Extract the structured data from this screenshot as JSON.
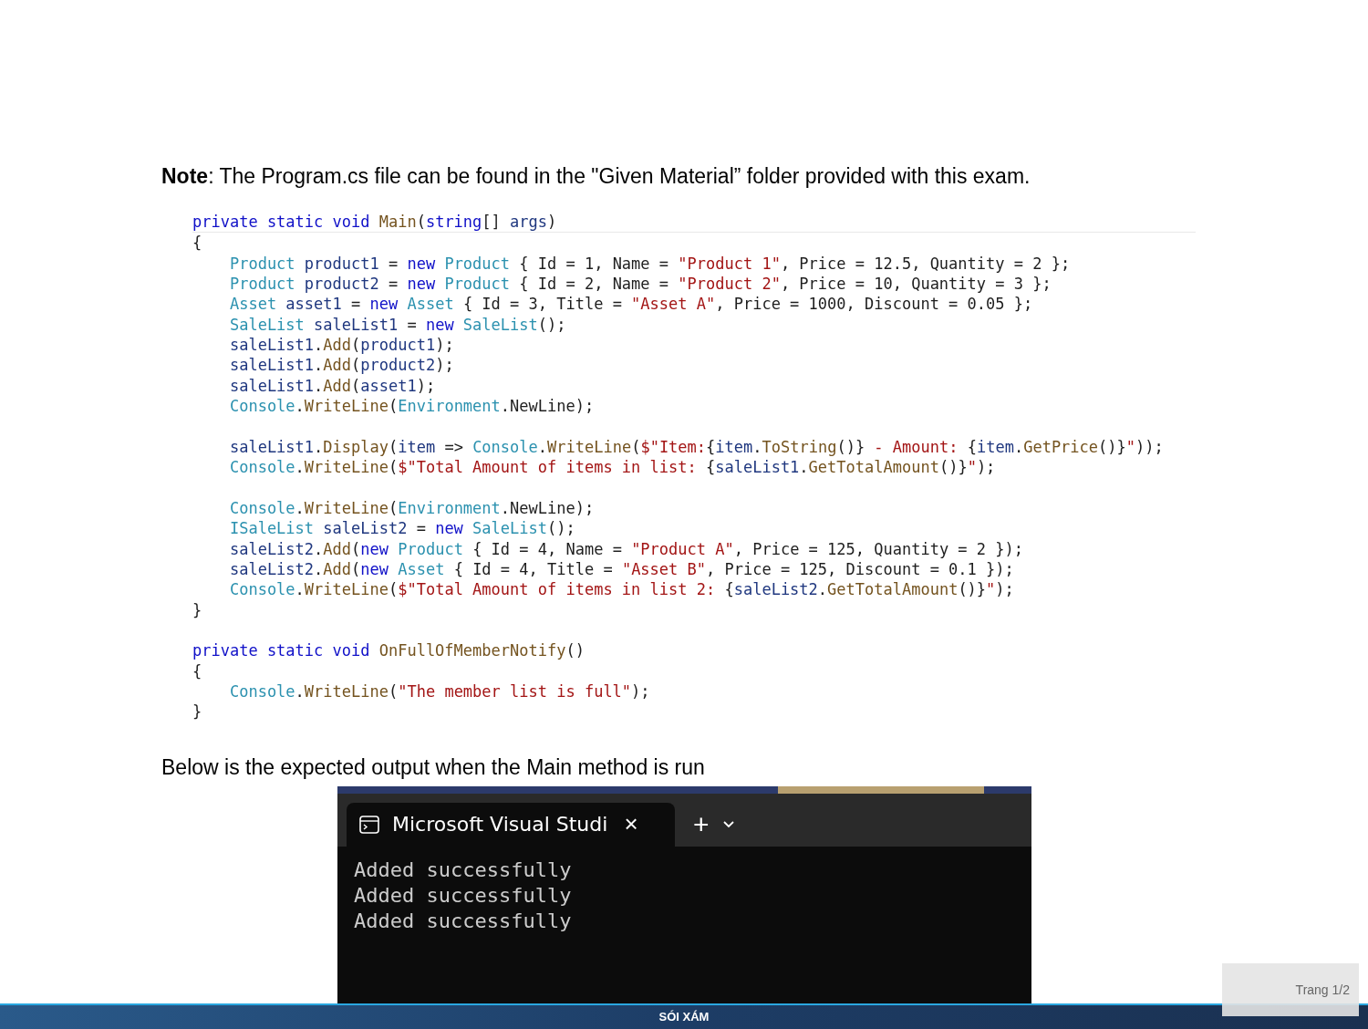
{
  "note": "**Note**: The Program.cs file can be found in the \"Given Material” folder provided with this exam.",
  "code_blocks": [
    {
      "lines": [
        {
          "tokens": [
            {
              "kind": "kw",
              "text": "private static void "
            },
            {
              "kind": "method",
              "text": "Main"
            },
            {
              "kind": "plain",
              "text": "("
            },
            {
              "kind": "kw",
              "text": "string"
            },
            {
              "kind": "plain",
              "text": "[] "
            },
            {
              "kind": "var",
              "text": "args"
            },
            {
              "kind": "plain",
              "text": ")"
            }
          ]
        },
        {
          "tokens": [
            {
              "kind": "plain",
              "text": "{"
            }
          ]
        },
        {
          "tokens": [
            {
              "kind": "type",
              "text": "    Product "
            },
            {
              "kind": "var",
              "text": "product1"
            },
            {
              "kind": "plain",
              "text": " = "
            },
            {
              "kind": "kw",
              "text": "new "
            },
            {
              "kind": "type",
              "text": "Product"
            },
            {
              "kind": "plain",
              "text": " { Id = 1, Name = "
            },
            {
              "kind": "str",
              "text": "\"Product 1\""
            },
            {
              "kind": "plain",
              "text": ", Price = 12.5, Quantity = 2 };"
            }
          ]
        },
        {
          "tokens": [
            {
              "kind": "type",
              "text": "    Product "
            },
            {
              "kind": "var",
              "text": "product2"
            },
            {
              "kind": "plain",
              "text": " = "
            },
            {
              "kind": "kw",
              "text": "new "
            },
            {
              "kind": "type",
              "text": "Product"
            },
            {
              "kind": "plain",
              "text": " { Id = 2, Name = "
            },
            {
              "kind": "str",
              "text": "\"Product 2\""
            },
            {
              "kind": "plain",
              "text": ", Price = 10, Quantity = 3 };"
            }
          ]
        },
        {
          "tokens": [
            {
              "kind": "type",
              "text": "    Asset "
            },
            {
              "kind": "var",
              "text": "asset1"
            },
            {
              "kind": "plain",
              "text": " = "
            },
            {
              "kind": "kw",
              "text": "new "
            },
            {
              "kind": "type",
              "text": "Asset"
            },
            {
              "kind": "plain",
              "text": " { Id = 3, Title = "
            },
            {
              "kind": "str",
              "text": "\"Asset A\""
            },
            {
              "kind": "plain",
              "text": ", Price = 1000, Discount = 0.05 };"
            }
          ]
        },
        {
          "tokens": [
            {
              "kind": "type",
              "text": "    SaleList "
            },
            {
              "kind": "var",
              "text": "saleList1"
            },
            {
              "kind": "plain",
              "text": " = "
            },
            {
              "kind": "kw",
              "text": "new "
            },
            {
              "kind": "type",
              "text": "SaleList"
            },
            {
              "kind": "plain",
              "text": "();"
            }
          ]
        },
        {
          "tokens": [
            {
              "kind": "var",
              "text": "    saleList1"
            },
            {
              "kind": "plain",
              "text": "."
            },
            {
              "kind": "method",
              "text": "Add"
            },
            {
              "kind": "plain",
              "text": "("
            },
            {
              "kind": "var",
              "text": "product1"
            },
            {
              "kind": "plain",
              "text": ");"
            }
          ]
        },
        {
          "tokens": [
            {
              "kind": "var",
              "text": "    saleList1"
            },
            {
              "kind": "plain",
              "text": "."
            },
            {
              "kind": "method",
              "text": "Add"
            },
            {
              "kind": "plain",
              "text": "("
            },
            {
              "kind": "var",
              "text": "product2"
            },
            {
              "kind": "plain",
              "text": ");"
            }
          ]
        },
        {
          "tokens": [
            {
              "kind": "var",
              "text": "    saleList1"
            },
            {
              "kind": "plain",
              "text": "."
            },
            {
              "kind": "method",
              "text": "Add"
            },
            {
              "kind": "plain",
              "text": "("
            },
            {
              "kind": "var",
              "text": "asset1"
            },
            {
              "kind": "plain",
              "text": ");"
            }
          ]
        },
        {
          "tokens": [
            {
              "kind": "type",
              "text": "    Console"
            },
            {
              "kind": "plain",
              "text": "."
            },
            {
              "kind": "method",
              "text": "WriteLine"
            },
            {
              "kind": "plain",
              "text": "("
            },
            {
              "kind": "type",
              "text": "Environment"
            },
            {
              "kind": "plain",
              "text": ".NewLine);"
            }
          ]
        }
      ]
    },
    {
      "lines": [
        {
          "tokens": [
            {
              "kind": "var",
              "text": "    saleList1"
            },
            {
              "kind": "plain",
              "text": "."
            },
            {
              "kind": "method",
              "text": "Display"
            },
            {
              "kind": "plain",
              "text": "("
            },
            {
              "kind": "var",
              "text": "item"
            },
            {
              "kind": "plain",
              "text": " => "
            },
            {
              "kind": "type",
              "text": "Console"
            },
            {
              "kind": "plain",
              "text": "."
            },
            {
              "kind": "method",
              "text": "WriteLine"
            },
            {
              "kind": "plain",
              "text": "("
            },
            {
              "kind": "str",
              "text": "$\"Item:"
            },
            {
              "kind": "plain",
              "text": "{"
            },
            {
              "kind": "var",
              "text": "item"
            },
            {
              "kind": "plain",
              "text": "."
            },
            {
              "kind": "method",
              "text": "ToString"
            },
            {
              "kind": "plain",
              "text": "()}"
            },
            {
              "kind": "str",
              "text": " - Amount: "
            },
            {
              "kind": "plain",
              "text": "{"
            },
            {
              "kind": "var",
              "text": "item"
            },
            {
              "kind": "plain",
              "text": "."
            },
            {
              "kind": "method",
              "text": "GetPrice"
            },
            {
              "kind": "plain",
              "text": "()}"
            },
            {
              "kind": "str",
              "text": "\""
            },
            {
              "kind": "plain",
              "text": "));"
            }
          ]
        },
        {
          "tokens": [
            {
              "kind": "type",
              "text": "    Console"
            },
            {
              "kind": "plain",
              "text": "."
            },
            {
              "kind": "method",
              "text": "WriteLine"
            },
            {
              "kind": "plain",
              "text": "("
            },
            {
              "kind": "str",
              "text": "$\"Total Amount of items in list: "
            },
            {
              "kind": "plain",
              "text": "{"
            },
            {
              "kind": "var",
              "text": "saleList1"
            },
            {
              "kind": "plain",
              "text": "."
            },
            {
              "kind": "method",
              "text": "GetTotalAmount"
            },
            {
              "kind": "plain",
              "text": "()}"
            },
            {
              "kind": "str",
              "text": "\""
            },
            {
              "kind": "plain",
              "text": ");"
            }
          ]
        }
      ]
    },
    {
      "lines": [
        {
          "tokens": [
            {
              "kind": "type",
              "text": "    Console"
            },
            {
              "kind": "plain",
              "text": "."
            },
            {
              "kind": "method",
              "text": "WriteLine"
            },
            {
              "kind": "plain",
              "text": "("
            },
            {
              "kind": "type",
              "text": "Environment"
            },
            {
              "kind": "plain",
              "text": ".NewLine);"
            }
          ]
        },
        {
          "tokens": [
            {
              "kind": "type",
              "text": "    ISaleList "
            },
            {
              "kind": "var",
              "text": "saleList2"
            },
            {
              "kind": "plain",
              "text": " = "
            },
            {
              "kind": "kw",
              "text": "new "
            },
            {
              "kind": "type",
              "text": "SaleList"
            },
            {
              "kind": "plain",
              "text": "();"
            }
          ]
        },
        {
          "tokens": [
            {
              "kind": "var",
              "text": "    saleList2"
            },
            {
              "kind": "plain",
              "text": "."
            },
            {
              "kind": "method",
              "text": "Add"
            },
            {
              "kind": "plain",
              "text": "("
            },
            {
              "kind": "kw",
              "text": "new "
            },
            {
              "kind": "type",
              "text": "Product"
            },
            {
              "kind": "plain",
              "text": " { Id = 4, Name = "
            },
            {
              "kind": "str",
              "text": "\"Product A\""
            },
            {
              "kind": "plain",
              "text": ", Price = 125, Quantity = 2 });"
            }
          ]
        },
        {
          "tokens": [
            {
              "kind": "var",
              "text": "    saleList2"
            },
            {
              "kind": "plain",
              "text": "."
            },
            {
              "kind": "method",
              "text": "Add"
            },
            {
              "kind": "plain",
              "text": "("
            },
            {
              "kind": "kw",
              "text": "new "
            },
            {
              "kind": "type",
              "text": "Asset"
            },
            {
              "kind": "plain",
              "text": " { Id = 4, Title = "
            },
            {
              "kind": "str",
              "text": "\"Asset B\""
            },
            {
              "kind": "plain",
              "text": ", Price = 125, Discount = 0.1 });"
            }
          ]
        },
        {
          "tokens": [
            {
              "kind": "type",
              "text": "    Console"
            },
            {
              "kind": "plain",
              "text": "."
            },
            {
              "kind": "method",
              "text": "WriteLine"
            },
            {
              "kind": "plain",
              "text": "("
            },
            {
              "kind": "str",
              "text": "$\"Total Amount of items in list 2: "
            },
            {
              "kind": "plain",
              "text": "{"
            },
            {
              "kind": "var",
              "text": "saleList2"
            },
            {
              "kind": "plain",
              "text": "."
            },
            {
              "kind": "method",
              "text": "GetTotalAmount"
            },
            {
              "kind": "plain",
              "text": "()}"
            },
            {
              "kind": "str",
              "text": "\""
            },
            {
              "kind": "plain",
              "text": ");"
            }
          ]
        },
        {
          "tokens": [
            {
              "kind": "plain",
              "text": "}"
            }
          ]
        }
      ]
    },
    {
      "lines": [
        {
          "tokens": [
            {
              "kind": "kw",
              "text": "private static void "
            },
            {
              "kind": "method",
              "text": "OnFullOfMemberNotify"
            },
            {
              "kind": "plain",
              "text": "()"
            }
          ]
        },
        {
          "tokens": [
            {
              "kind": "plain",
              "text": "{"
            }
          ]
        },
        {
          "tokens": [
            {
              "kind": "type",
              "text": "    Console"
            },
            {
              "kind": "plain",
              "text": "."
            },
            {
              "kind": "method",
              "text": "WriteLine"
            },
            {
              "kind": "plain",
              "text": "("
            },
            {
              "kind": "str",
              "text": "\"The member list is full\""
            },
            {
              "kind": "plain",
              "text": ");"
            }
          ]
        },
        {
          "tokens": [
            {
              "kind": "plain",
              "text": "}"
            }
          ]
        }
      ]
    }
  ],
  "output_caption": "Below is the expected output when the Main method is run",
  "terminal": {
    "tab_title": "Microsoft Visual Studi",
    "close": "×",
    "new_tab": "+",
    "lines": [
      "Added successfully",
      "Added successfully",
      "Added successfully"
    ]
  },
  "footer": {
    "title": "SÓI XÁM",
    "page": "Trang 1/2"
  }
}
